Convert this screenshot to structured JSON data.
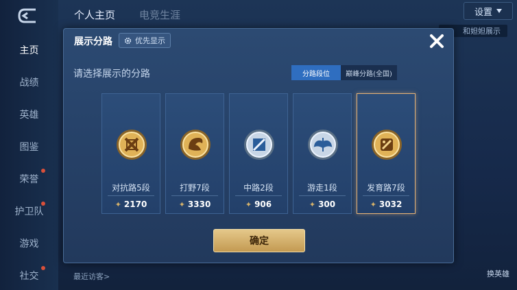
{
  "nav": {
    "items": [
      {
        "label": "主页",
        "active": true
      },
      {
        "label": "战绩"
      },
      {
        "label": "英雄"
      },
      {
        "label": "图鉴"
      },
      {
        "label": "荣誉"
      },
      {
        "label": "护卫队"
      },
      {
        "label": "游戏"
      },
      {
        "label": "社交"
      }
    ]
  },
  "top": {
    "tab1": "个人主页",
    "tab2": "电竞生涯",
    "settings": "设置",
    "show_button": "和妲妲展示"
  },
  "bottom": {
    "visitors": "最近访客>",
    "swap_hero": "换英雄"
  },
  "modal": {
    "title": "展示分路",
    "priority_label": "优先显示",
    "prompt": "请选择展示的分路",
    "tabs": [
      {
        "label": "分路段位",
        "active": true
      },
      {
        "label": "巅峰分路(全国)",
        "active": false
      }
    ],
    "lanes": [
      {
        "label": "对抗路5段",
        "score": "2170",
        "emblem": "clash-lane-emblem",
        "tier": "gold",
        "selected": false
      },
      {
        "label": "打野7段",
        "score": "3330",
        "emblem": "jungle-dragon-emblem",
        "tier": "gold",
        "selected": false
      },
      {
        "label": "中路2段",
        "score": "906",
        "emblem": "mid-lane-emblem",
        "tier": "silver",
        "selected": false
      },
      {
        "label": "游走1段",
        "score": "300",
        "emblem": "roam-wing-emblem",
        "tier": "silver",
        "selected": false
      },
      {
        "label": "发育路7段",
        "score": "3032",
        "emblem": "farm-lane-emblem",
        "tier": "gold",
        "selected": true
      }
    ],
    "confirm": "确定"
  },
  "colors": {
    "accent_gold": "#e6b377",
    "tab_active": "#2f6ec0",
    "modal_bg": "#27436a"
  }
}
